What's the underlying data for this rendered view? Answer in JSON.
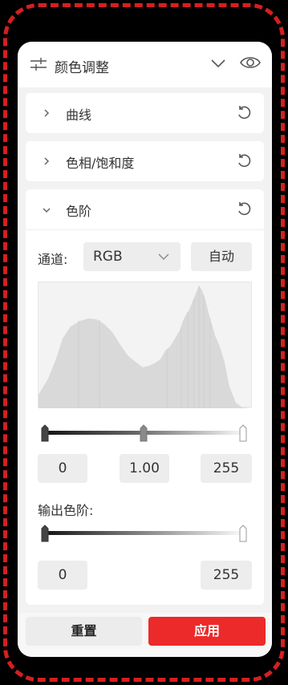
{
  "panel": {
    "title": "颜色调整",
    "icons": {
      "adjust": "sliders-icon",
      "collapse": "chevron-down-icon",
      "visibility": "eye-icon"
    }
  },
  "sections": [
    {
      "label": "曲线",
      "expanded": false
    },
    {
      "label": "色相/饱和度",
      "expanded": false
    },
    {
      "label": "色阶",
      "expanded": true
    }
  ],
  "levels": {
    "channel_label": "通道:",
    "channel_value": "RGB",
    "auto_label": "自动",
    "input": {
      "black": "0",
      "gamma": "1.00",
      "white": "255",
      "black_pos": 0,
      "gamma_pos": 0.5,
      "white_pos": 1
    },
    "output_label": "输出色阶:",
    "output": {
      "black": "0",
      "white": "255",
      "black_pos": 0,
      "white_pos": 1
    }
  },
  "footer": {
    "reset_label": "重置",
    "apply_label": "应用"
  },
  "colors": {
    "accent": "#ec2a2a",
    "frame": "#d51f1f"
  }
}
